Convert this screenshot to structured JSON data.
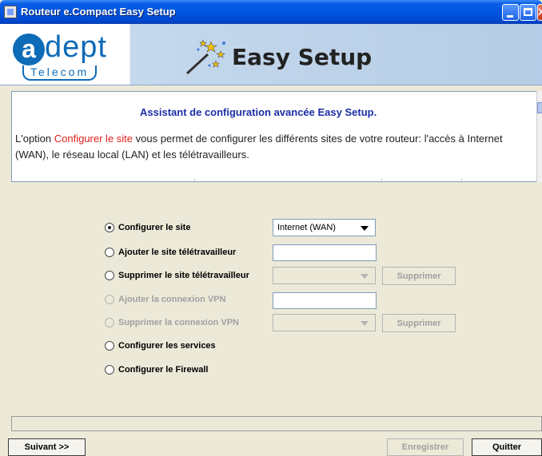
{
  "window": {
    "title": "Routeur e.Compact Easy Setup",
    "controls": {
      "minimize": "",
      "maximize": "",
      "close": "X"
    }
  },
  "header": {
    "logo_letter": "a",
    "logo_word": "dept",
    "logo_subtitle": "Telecom",
    "product_title": "Easy Setup"
  },
  "info": {
    "heading": "Assistant de configuration avancée Easy Setup.",
    "text_before": "L'option ",
    "text_highlight": "Configurer le site",
    "text_after": " vous permet de configurer les différents sites de votre routeur: l'accès à Internet (WAN), le réseau local (LAN) et les télétravailleurs."
  },
  "options": {
    "configure_site": {
      "label": "Configurer le site",
      "selected": true,
      "select_value": "Internet (WAN)"
    },
    "add_teleworker": {
      "label": "Ajouter le site télétravailleur",
      "selected": false,
      "input_value": ""
    },
    "remove_teleworker": {
      "label": "Supprimer le site télétravailleur",
      "selected": false,
      "select_value": "",
      "button_label": "Supprimer"
    },
    "add_vpn": {
      "label": "Ajouter la connexion VPN",
      "selected": false,
      "disabled": true,
      "input_value": ""
    },
    "remove_vpn": {
      "label": "Supprimer la connexion VPN",
      "selected": false,
      "disabled": true,
      "select_value": "",
      "button_label": "Supprimer"
    },
    "configure_services": {
      "label": "Configurer les services",
      "selected": false
    },
    "configure_firewall": {
      "label": "Configurer le Firewall",
      "selected": false
    }
  },
  "footer": {
    "status_text": "",
    "next_label": "Suivant >>",
    "save_label": "Enregistrer",
    "quit_label": "Quitter"
  }
}
